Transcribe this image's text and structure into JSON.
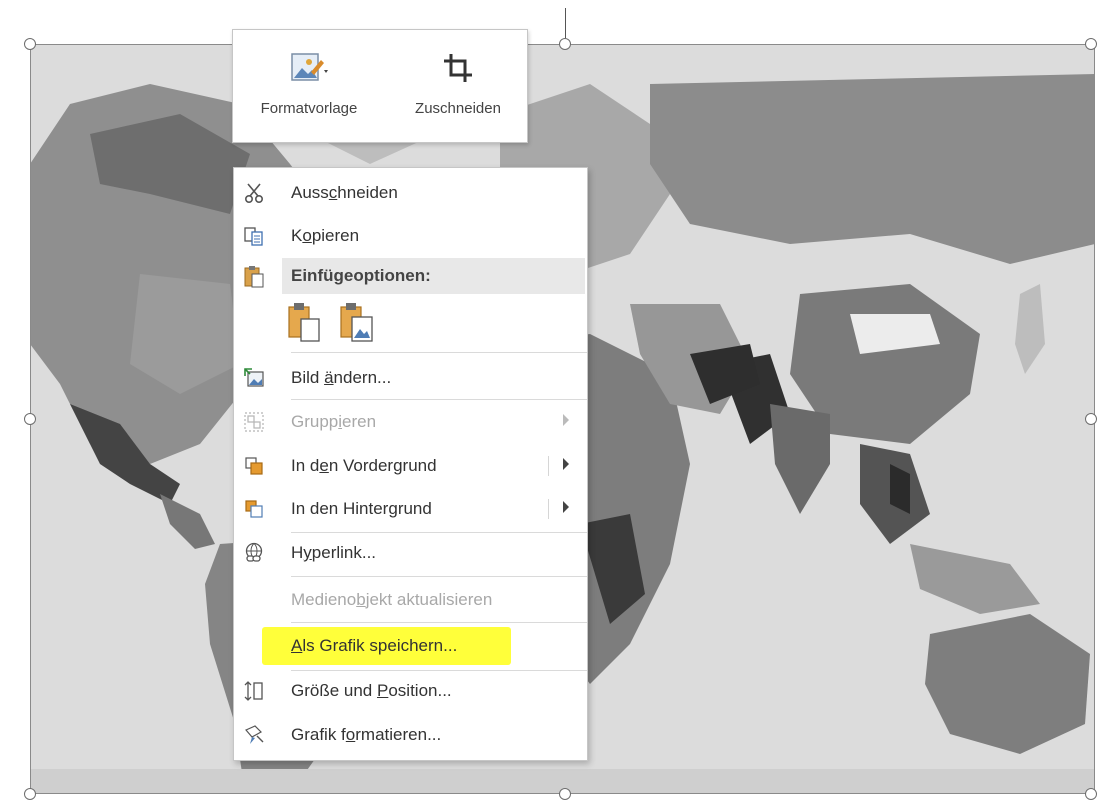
{
  "toolbar": {
    "format_label": "Formatvorlage",
    "crop_label": "Zuschneiden"
  },
  "menu": {
    "cut": {
      "label": "Ausschneiden",
      "accel": "c"
    },
    "copy": {
      "label": "Kopieren",
      "accel": "o"
    },
    "paste_header": "Einfügeoptionen:",
    "change_picture": {
      "label": "Bild ändern...",
      "accel": "ä"
    },
    "group": {
      "label": "Gruppieren",
      "accel": "i",
      "disabled": true
    },
    "bring_front": {
      "label": "In den Vordergrund",
      "accel": "e"
    },
    "send_back": {
      "label": "In den Hintergrund",
      "accel": "g"
    },
    "hyperlink": {
      "label": "Hyperlink...",
      "accel": "y"
    },
    "update_media": {
      "label": "Medienobjekt aktualisieren",
      "accel": "b",
      "disabled": true
    },
    "save_as_picture": {
      "label": "Als Grafik speichern...",
      "accel": "A"
    },
    "size_position": {
      "label": "Größe und Position...",
      "accel": "P"
    },
    "format_picture": {
      "label": "Grafik formatieren...",
      "accel": "o"
    }
  },
  "icons": {
    "format": "picture-style-icon",
    "crop": "crop-icon",
    "cut": "scissors-icon",
    "copy": "copy-icon",
    "paste": "clipboard-icon",
    "change_picture": "change-picture-icon",
    "group": "group-icon",
    "bring_front": "bring-forward-icon",
    "send_back": "send-backward-icon",
    "hyperlink": "hyperlink-icon",
    "size_position": "size-position-icon",
    "format_picture": "format-picture-icon"
  },
  "colors": {
    "highlight": "#ffff3a",
    "menu_text": "#333333",
    "disabled_text": "#a8a8a8",
    "header_bg": "#e8e8e8"
  }
}
